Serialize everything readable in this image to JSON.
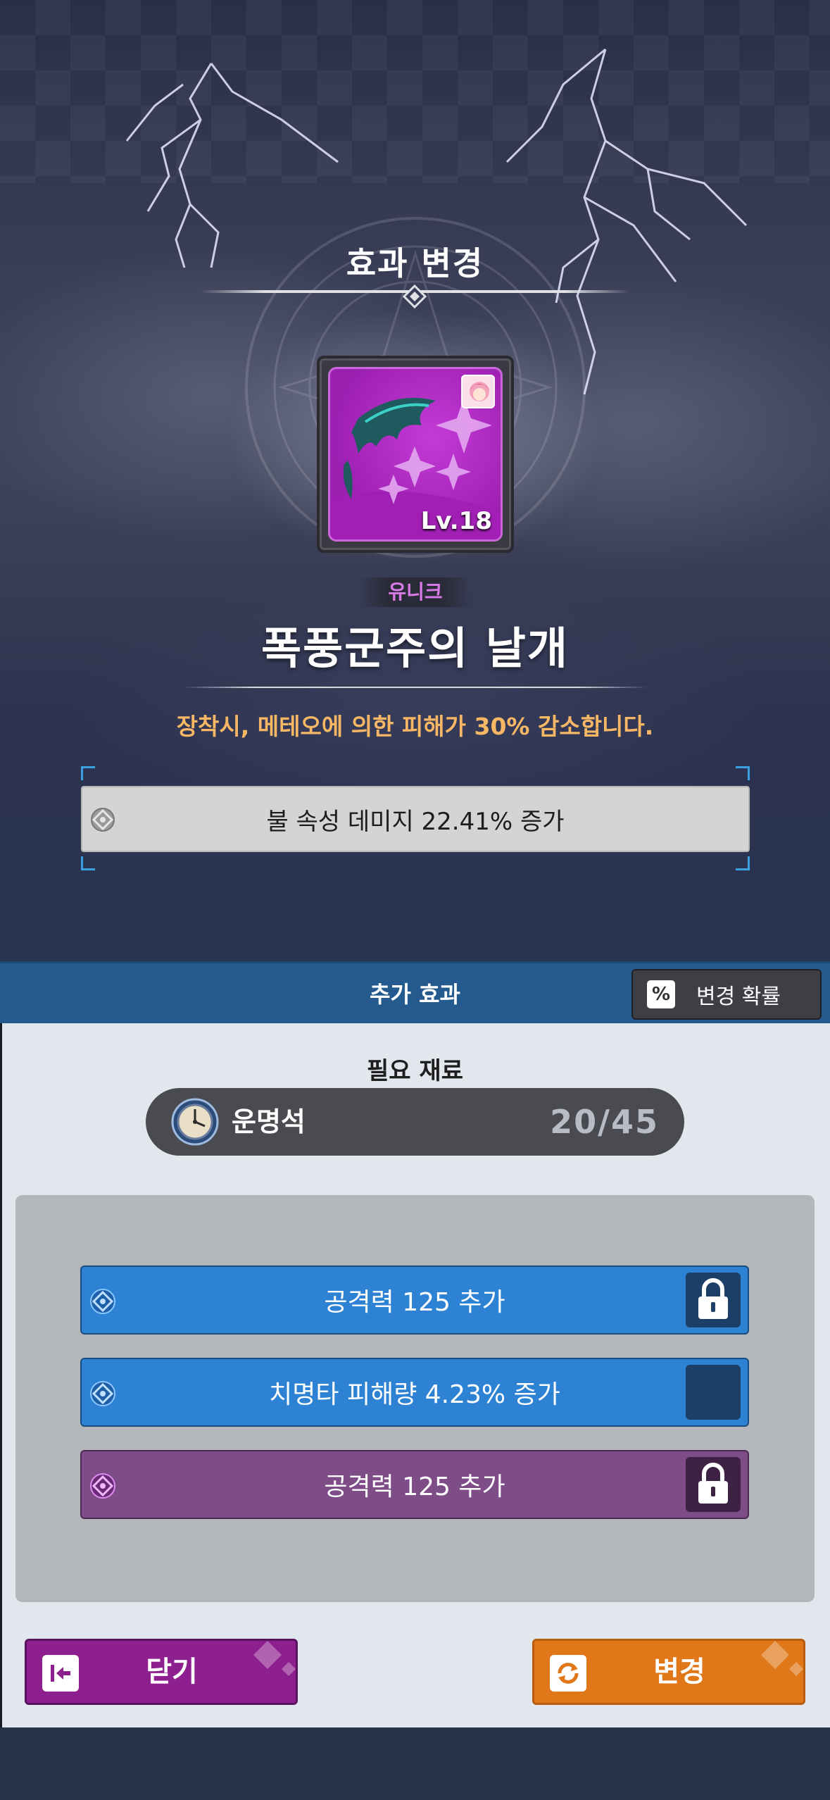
{
  "header": {
    "title": "효과 변경"
  },
  "item": {
    "level": "Lv.18",
    "rarity": "유니크",
    "name": "폭풍군주의 날개",
    "description": "장착시, 메테오에 의한 피해가 30% 감소합니다.",
    "main_effect": "불 속성 데미지 22.41% 증가"
  },
  "tab": {
    "title": "추가 효과",
    "probability_icon": "%",
    "probability_label": "변경 확률"
  },
  "materials": {
    "label": "필요 재료",
    "name": "운명석",
    "count": "20/45"
  },
  "options": [
    {
      "text": "공격력 125 추가",
      "color": "blue",
      "locked": true
    },
    {
      "text": "치명타 피해량 4.23% 증가",
      "color": "blue",
      "locked": false
    },
    {
      "text": "공격력 125 추가",
      "color": "purple",
      "locked": true
    }
  ],
  "buttons": {
    "close_label": "닫기",
    "change_label": "변경"
  },
  "colors": {
    "rarity": "#d97be6",
    "description": "#f7b765",
    "blue_option": "#2e82d3",
    "purple_option": "#7e4c87",
    "close_button": "#8e1f8e",
    "change_button": "#e0781a"
  },
  "icons": {
    "option": "option-gear-icon",
    "lock": "lock-icon",
    "material": "compass-stone-icon",
    "close": "exit-arrow-icon",
    "change": "refresh-icon"
  }
}
